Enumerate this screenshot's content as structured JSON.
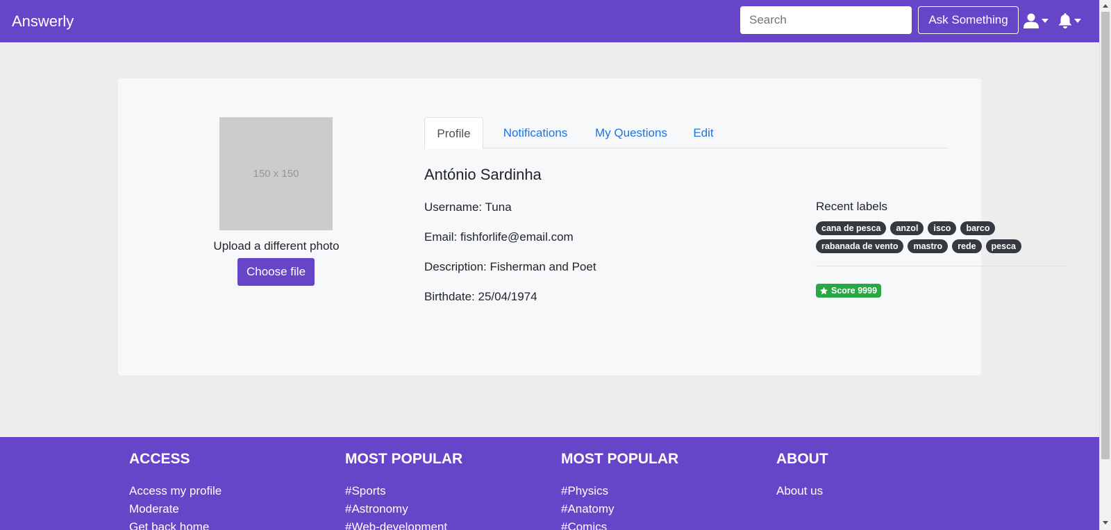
{
  "navbar": {
    "brand": "Answerly",
    "search_placeholder": "Search",
    "ask_label": "Ask Something",
    "user_icon": "user-icon",
    "bell_icon": "bell-icon"
  },
  "profile": {
    "avatar_placeholder": "150 x 150",
    "upload_label": "Upload a different photo",
    "choose_file_label": "Choose file",
    "tabs": [
      {
        "label": "Profile",
        "active": true
      },
      {
        "label": "Notifications",
        "active": false
      },
      {
        "label": "My Questions",
        "active": false
      },
      {
        "label": "Edit",
        "active": false
      }
    ],
    "name": "António Sardinha",
    "username": "Username: Tuna",
    "email": "Email: fishforlife@email.com",
    "description": "Description: Fisherman and Poet",
    "birthdate": "Birthdate: 25/04/1974",
    "recent_labels_title": "Recent labels",
    "labels": [
      "cana de pesca",
      "anzol",
      "isco",
      "barco",
      "rabanada de vento",
      "mastro",
      "rede",
      "pesca"
    ],
    "score_label": "Score 9999"
  },
  "footer": {
    "columns": [
      {
        "title": "ACCESS",
        "links": [
          "Access my profile",
          "Moderate",
          "Get back home"
        ]
      },
      {
        "title": "MOST POPULAR",
        "links": [
          "#Sports",
          "#Astronomy",
          "#Web-development"
        ]
      },
      {
        "title": "MOST POPULAR",
        "links": [
          "#Physics",
          "#Anatomy",
          "#Comics"
        ]
      },
      {
        "title": "ABOUT",
        "links": [
          "About us"
        ]
      }
    ]
  },
  "colors": {
    "brand": "#6745c9",
    "link": "#1f73e0",
    "tag": "#343a40",
    "score": "#28a745",
    "background": "#ededed"
  }
}
